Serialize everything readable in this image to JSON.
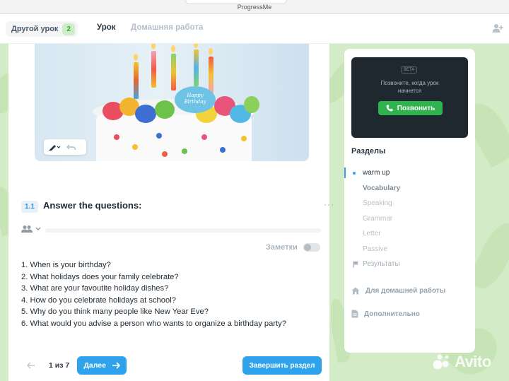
{
  "window": {
    "title": "ProgressMe"
  },
  "header": {
    "other_lesson_label": "Другой урок",
    "other_lesson_count": "2",
    "tabs": [
      {
        "label": "Урок"
      },
      {
        "label": "Домашняя работа"
      }
    ],
    "add_participant_icon": "person-add-icon"
  },
  "image_card": {
    "plaque_line1": "Happy",
    "plaque_line2": "Birthday"
  },
  "exercise": {
    "number": "1.1",
    "title": "Answer the questions:",
    "notes_label": "Заметки",
    "notes_enabled": false,
    "questions": [
      "1. When is your birthday?",
      "2. What holidays does your family celebrate?",
      "3. What are your favoutite holiday dishes?",
      "4. How do you celebrate holidays at school?",
      "5. Why do you think many people like New Year Eve?",
      "6. What would you advise a person who wants to organize a birthday party?"
    ]
  },
  "pagination": {
    "counter": "1 из 7",
    "next_label": "Далее",
    "finish_label": "Завершить раздел"
  },
  "sidebar": {
    "video": {
      "beta": "BETA",
      "message_line1": "Позвоните, когда урок",
      "message_line2": "начнется",
      "call_label": "Позвонить"
    },
    "sections_title": "Разделы",
    "sections": [
      {
        "label": "warm up",
        "state": "active"
      },
      {
        "label": "Vocabulary",
        "state": "done"
      },
      {
        "label": "Speaking",
        "state": "pending"
      },
      {
        "label": "Grammar",
        "state": "pending"
      },
      {
        "label": "Letter",
        "state": "pending"
      },
      {
        "label": "Passive",
        "state": "pending"
      },
      {
        "label": "Результаты",
        "state": "results"
      }
    ],
    "homework_label": "Для домашней работы",
    "extra_label": "Дополнительно"
  },
  "watermark": {
    "text": "Avito"
  },
  "colors": {
    "accent": "#2ea3ec",
    "call_green": "#2fb34d",
    "page_bg": "#d4ebc7",
    "video_bg": "#1f272f"
  }
}
